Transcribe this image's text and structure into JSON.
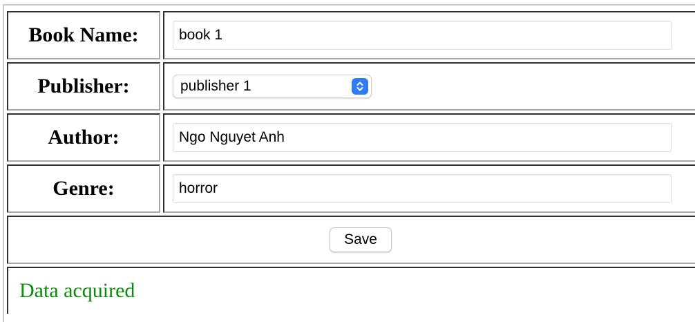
{
  "form": {
    "book_name": {
      "label": "Book Name:",
      "value": "book 1"
    },
    "publisher": {
      "label": "Publisher:",
      "selected": "publisher 1",
      "arrow_icon": "chevron-up-down-icon"
    },
    "author": {
      "label": "Author:",
      "value": "Ngo Nguyet Anh"
    },
    "genre": {
      "label": "Genre:",
      "value": "horror"
    },
    "save_label": "Save",
    "status_message": "Data acquired"
  },
  "colors": {
    "status_text": "#0b8a0b",
    "select_accent": "#2f7cf6",
    "cell_border_dark": "#2f2f2f",
    "cell_border_light": "#a8a8a8"
  }
}
